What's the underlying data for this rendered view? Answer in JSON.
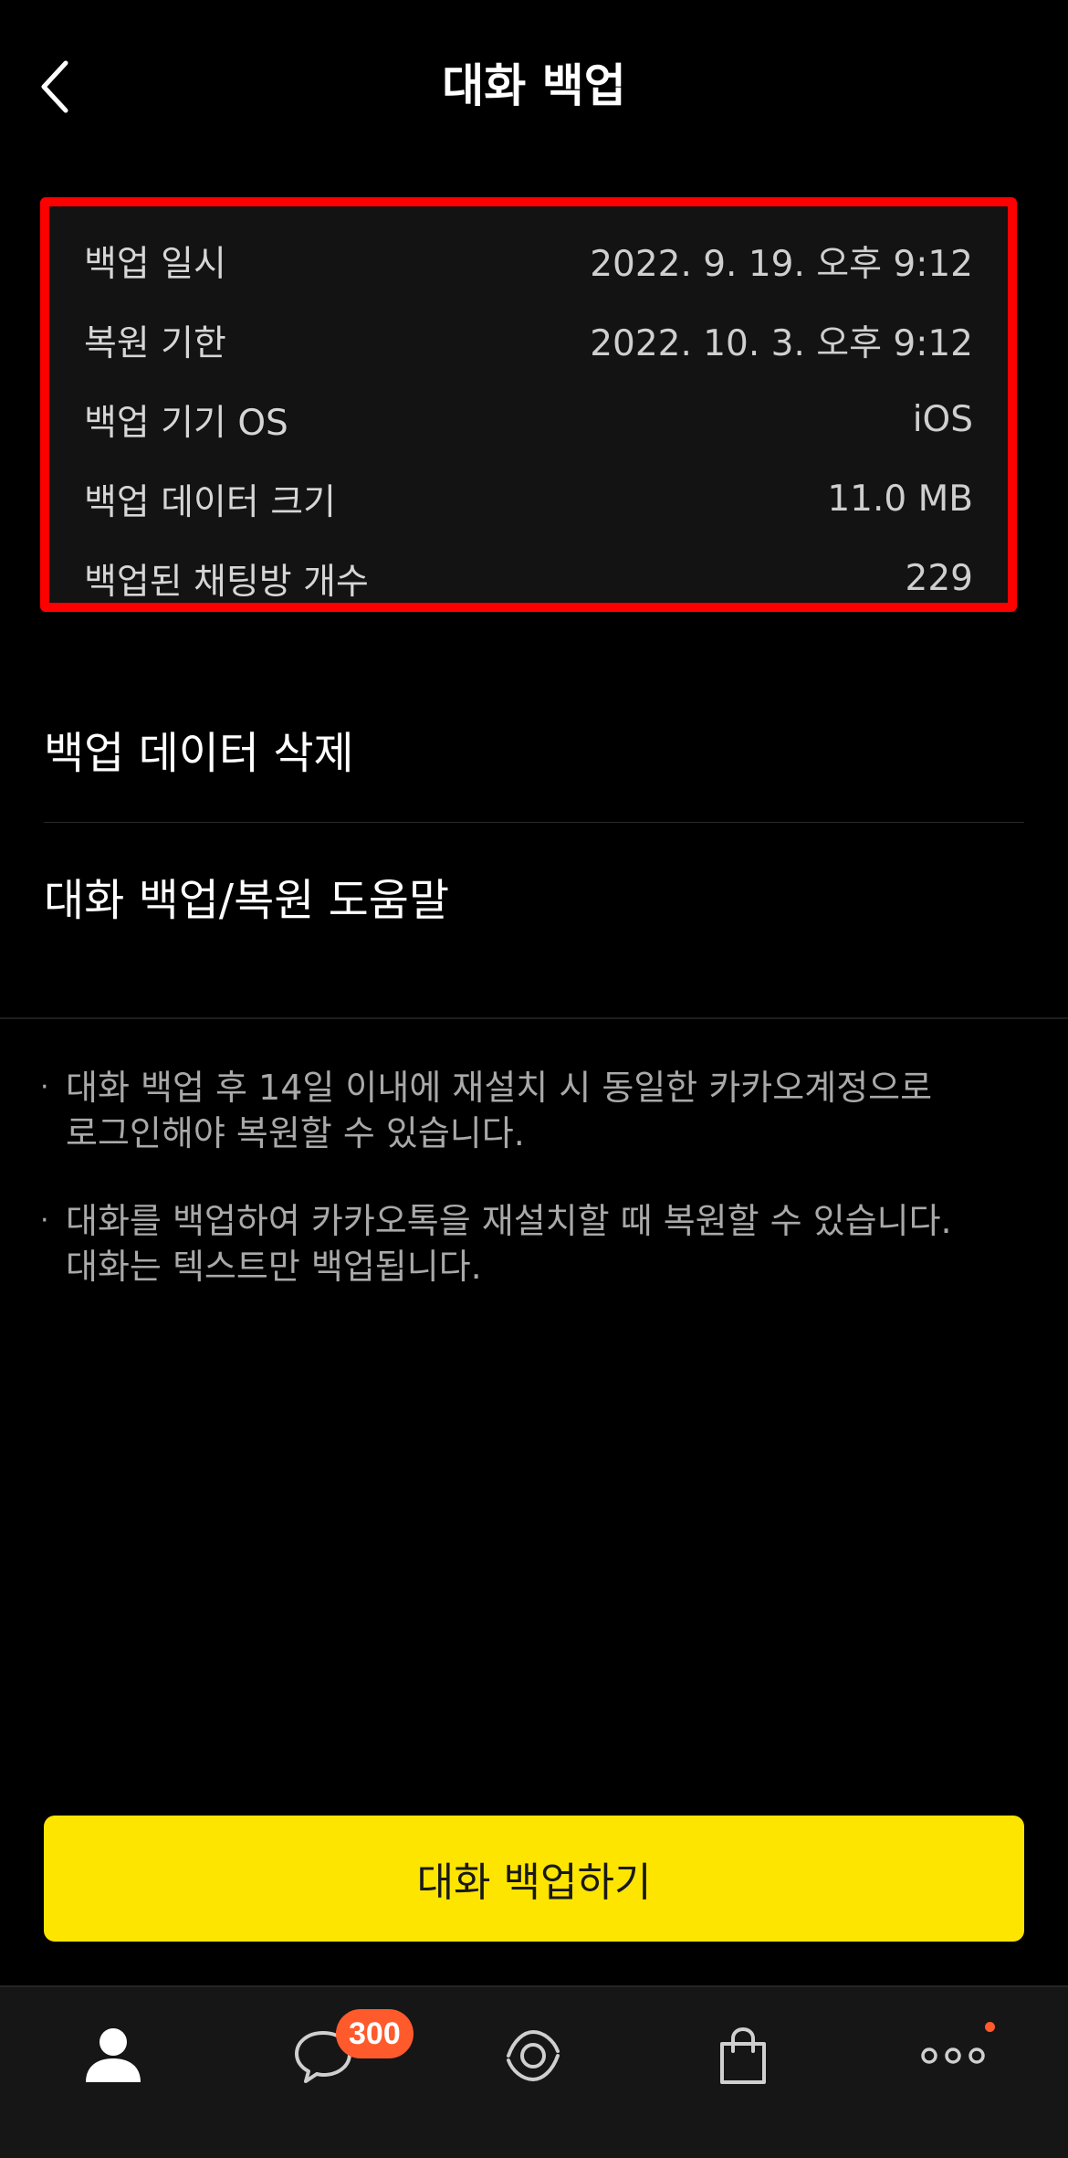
{
  "header": {
    "title": "대화 백업"
  },
  "backup_info": [
    {
      "label": "백업 일시",
      "value": "2022. 9. 19. 오후 9:12"
    },
    {
      "label": "복원 기한",
      "value": "2022. 10. 3. 오후 9:12"
    },
    {
      "label": "백업 기기 OS",
      "value": "iOS"
    },
    {
      "label": "백업 데이터 크기",
      "value": "11.0 MB"
    },
    {
      "label": "백업된 채팅방 개수",
      "value": "229"
    }
  ],
  "menu": {
    "delete_backup": "백업 데이터 삭제",
    "help": "대화 백업/복원 도움말"
  },
  "notes": [
    {
      "line1": "대화 백업 후 14일 이내에 재설치 시 동일한 카카오계정으로",
      "line2": "로그인해야 복원할 수 있습니다."
    },
    {
      "line1": "대화를 백업하여 카카오톡을 재설치할 때 복원할 수 있습니다.",
      "line2": "대화는 텍스트만 백업됩니다."
    }
  ],
  "bullet": "·",
  "actions": {
    "backup_button": "대화 백업하기"
  },
  "tabbar": {
    "chat_badge": "300"
  },
  "colors": {
    "accent_button": "#fee500",
    "highlight_border": "#ff0000",
    "badge": "#ff5a2c"
  }
}
